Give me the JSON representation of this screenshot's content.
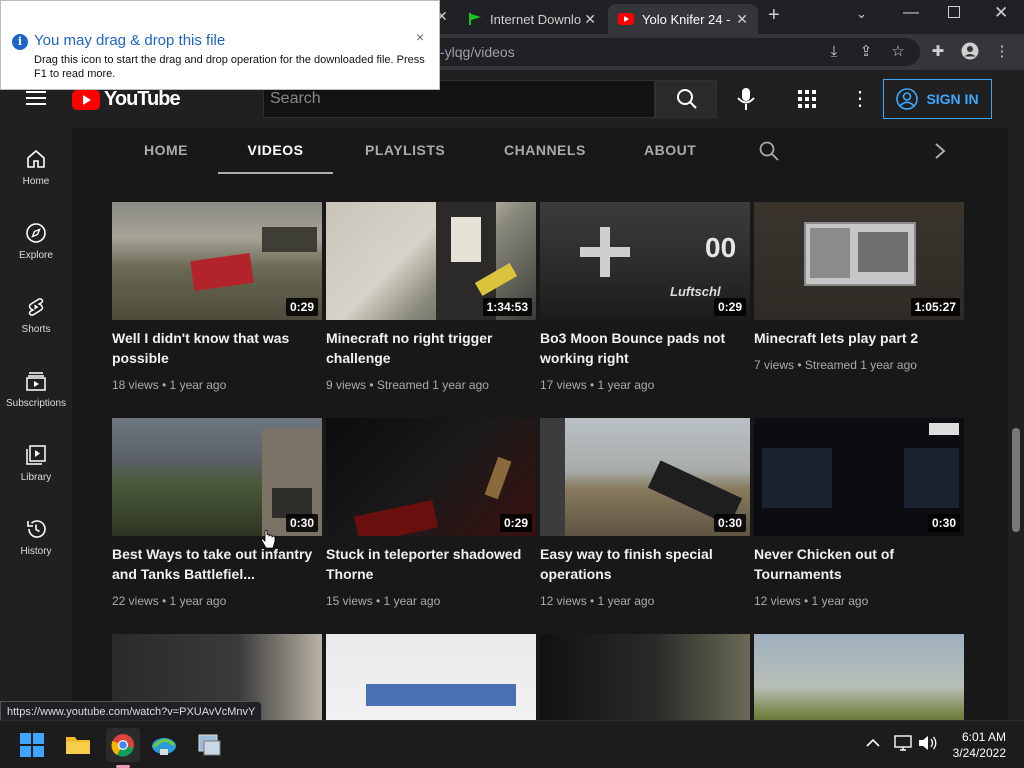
{
  "browser": {
    "tabs": [
      {
        "label": "Internet Downlo"
      },
      {
        "label": "Yolo Knifer 24 -"
      }
    ],
    "url_visible": "-ylqg/videos",
    "new_tab": "+"
  },
  "popup": {
    "title": "You may drag & drop this file",
    "body": "Drag this icon to start the drag and drop operation for the downloaded file. Press F1 to read more.",
    "close": "×"
  },
  "header": {
    "logo_text": "YouTube",
    "search_placeholder": "Search",
    "signin_label": "SIGN IN"
  },
  "sidebar": {
    "items": [
      {
        "label": "Home"
      },
      {
        "label": "Explore"
      },
      {
        "label": "Shorts"
      },
      {
        "label": "Subscriptions"
      },
      {
        "label": "Library"
      },
      {
        "label": "History"
      }
    ]
  },
  "channel_tabs": [
    "HOME",
    "VIDEOS",
    "PLAYLISTS",
    "CHANNELS",
    "ABOUT"
  ],
  "videos": [
    {
      "title": "Well I didn't know that was possible",
      "meta": "18 views • 1 year ago",
      "duration": "0:29"
    },
    {
      "title": "Minecraft no right trigger challenge",
      "meta": "9 views • Streamed 1 year ago",
      "duration": "1:34:53"
    },
    {
      "title": "Bo3 Moon Bounce pads not working right",
      "meta": "17 views • 1 year ago",
      "duration": "0:29"
    },
    {
      "title": "Minecraft lets play part 2",
      "meta": "7 views • Streamed 1 year ago",
      "duration": "1:05:27"
    },
    {
      "title": "Best Ways to take out infantry and Tanks Battlefiel...",
      "meta": "22 views • 1 year ago",
      "duration": "0:30"
    },
    {
      "title": "Stuck in teleporter shadowed Thorne",
      "meta": "15 views • 1 year ago",
      "duration": "0:29"
    },
    {
      "title": "Easy way to finish special operations",
      "meta": "12 views • 1 year ago",
      "duration": "0:30"
    },
    {
      "title": "Never Chicken out of Tournaments",
      "meta": "12 views • 1 year ago",
      "duration": "0:30"
    }
  ],
  "status_url": "https://www.youtube.com/watch?v=PXUAvVcMnvY",
  "taskbar": {
    "time": "6:01 AM",
    "date": "3/24/2022"
  },
  "colors": {
    "accent_blue": "#3ea6ff",
    "youtube_red": "#ff0000",
    "popup_title": "#1e64c8"
  }
}
